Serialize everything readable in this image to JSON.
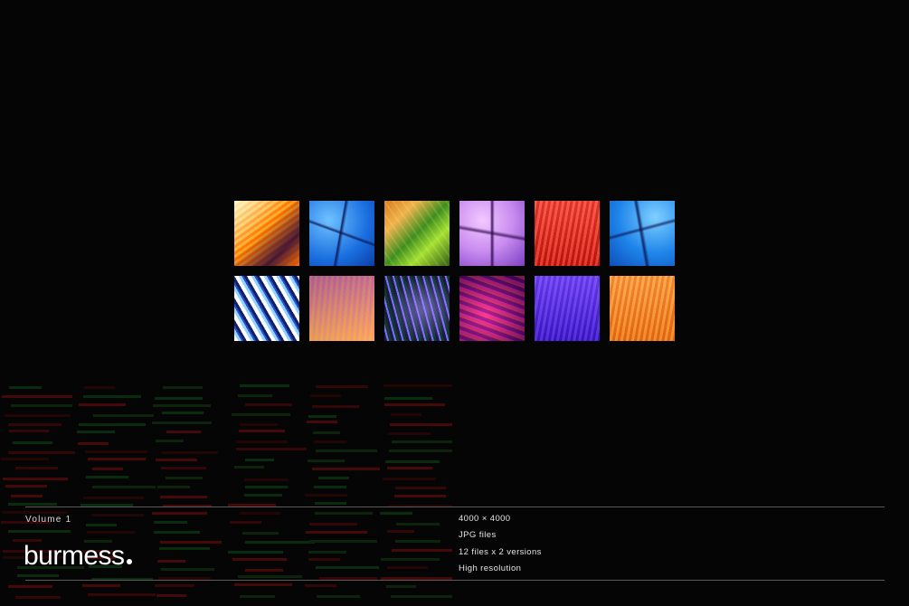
{
  "brand": {
    "name": "burmess"
  },
  "volume_label": "Volume 1",
  "specs": [
    "4000 × 4000",
    "JPG files",
    "12 files x 2 versions",
    "High resolution"
  ],
  "thumbnails": [
    {
      "name": "orange-yellow-ribbed"
    },
    {
      "name": "blue-inflated"
    },
    {
      "name": "green-orange-twist"
    },
    {
      "name": "lilac-inflated"
    },
    {
      "name": "red-ribbed"
    },
    {
      "name": "blue-inflated-2"
    },
    {
      "name": "white-blue-glitch"
    },
    {
      "name": "pink-orange-ribbed"
    },
    {
      "name": "dark-violet-waves"
    },
    {
      "name": "magenta-glitch"
    },
    {
      "name": "purple-ribbed"
    },
    {
      "name": "orange-ribbed"
    }
  ],
  "colors": {
    "background": "#050505",
    "text": "#ffffff",
    "rule": "#5b5b5b"
  }
}
